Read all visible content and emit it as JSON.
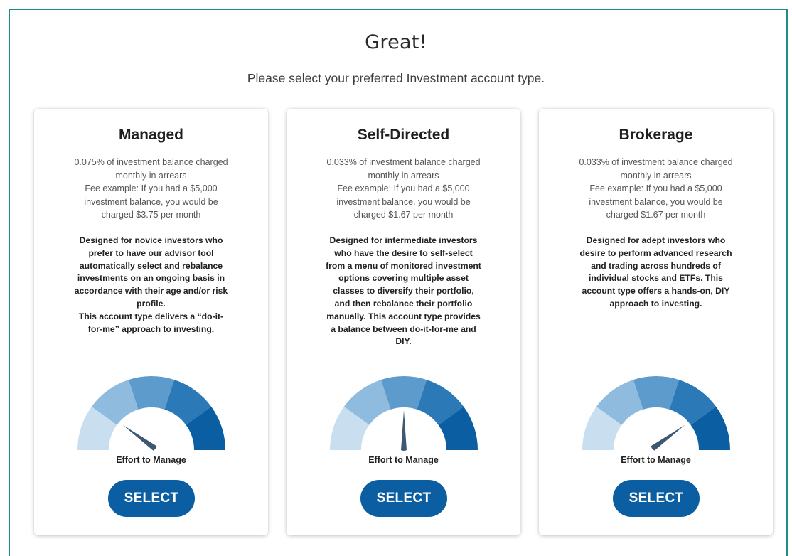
{
  "header": {
    "title": "Great!",
    "subtitle": "Please select your preferred Investment account type."
  },
  "colors": {
    "frame_border": "#1f8a8a",
    "button": "#0b5ea1",
    "gauge_segments": [
      "#c9dff0",
      "#8fbcde",
      "#5d9bcd",
      "#2b79b7",
      "#0b5ea1"
    ],
    "needle": "#3e5872"
  },
  "cards": [
    {
      "title": "Managed",
      "fee_lines": [
        "0.075% of investment balance charged",
        "monthly in arrears",
        "Fee example: If you had a $5,000",
        "investment balance, you would be",
        "charged $3.75 per month"
      ],
      "description_lines": [
        "Designed for novice investors who",
        "prefer to have our advisor tool",
        "automatically select and rebalance",
        "investments on an ongoing basis in",
        "accordance with their age and/or risk",
        "profile.",
        "This account type delivers a “do-it-",
        "for-me” approach to investing."
      ],
      "effort_level": 0.2,
      "effort_label": "Effort to Manage",
      "button_label": "SELECT"
    },
    {
      "title": "Self-Directed",
      "fee_lines": [
        "0.033% of investment balance charged",
        "monthly in arrears",
        "Fee example: If you had a $5,000",
        "investment balance, you would be",
        "charged $1.67 per month"
      ],
      "description_lines": [
        "Designed for intermediate investors",
        "who have the desire to self-select",
        "from a menu of monitored investment",
        "options covering multiple asset",
        "classes to diversify their portfolio,",
        "and then rebalance their portfolio",
        "manually. This account type provides",
        "a balance between do-it-for-me and",
        "DIY."
      ],
      "effort_level": 0.5,
      "effort_label": "Effort to Manage",
      "button_label": "SELECT"
    },
    {
      "title": "Brokerage",
      "fee_lines": [
        "0.033% of investment balance charged",
        "monthly in arrears",
        "Fee example: If you had a $5,000",
        "investment balance, you would be",
        "charged $1.67 per month"
      ],
      "description_lines": [
        "Designed for adept investors who",
        "desire to perform advanced research",
        "and trading across hundreds of",
        "individual stocks and ETFs. This",
        "account type offers a hands-on, DIY",
        "approach to investing."
      ],
      "effort_level": 0.8,
      "effort_label": "Effort to Manage",
      "button_label": "SELECT"
    }
  ]
}
